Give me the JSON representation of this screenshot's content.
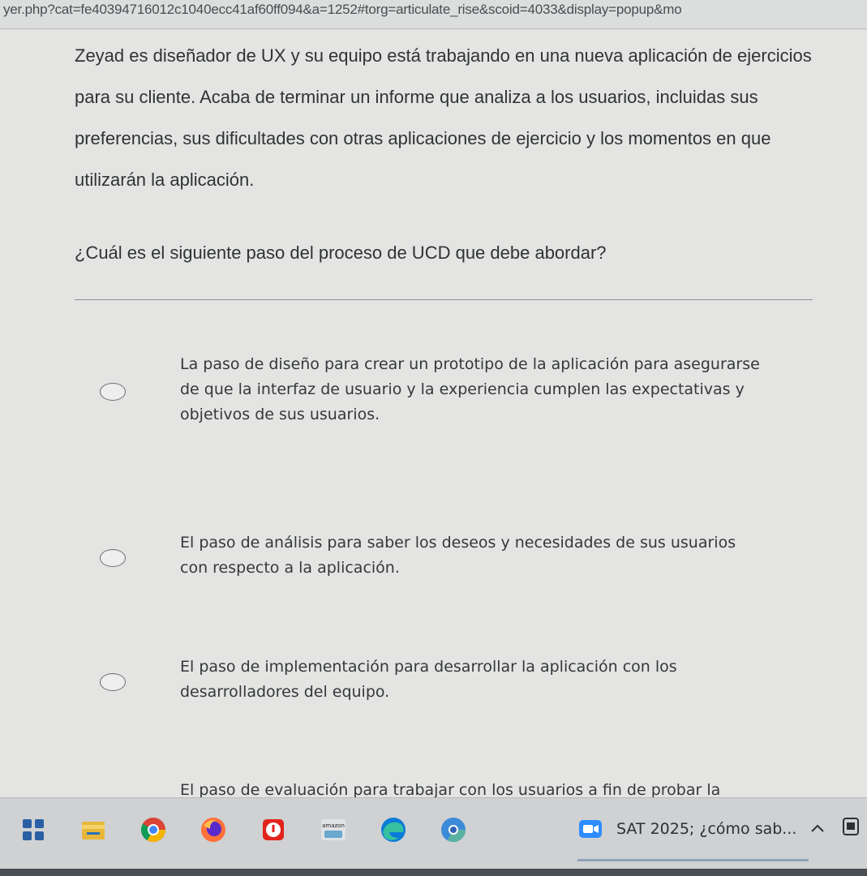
{
  "browser": {
    "url": "yer.php?cat=fe40394716012c1040ecc41af60ff094&a=1252#torg=articulate_rise&scoid=4033&display=popup&mo"
  },
  "question": {
    "body": "Zeyad es diseñador de UX y su equipo está trabajando en una nueva aplicación de ejercicios para su cliente. Acaba de terminar un informe que analiza a los usuarios, incluidas sus preferencias, sus dificultades con otras aplicaciones de ejercicio y los momentos en que utilizarán la aplicación.",
    "prompt": "¿Cuál es el siguiente paso del proceso de UCD que debe abordar?"
  },
  "options": [
    {
      "text": "La paso de diseño para crear un prototipo de la aplicación para asegurarse de que la interfaz de usuario y la experiencia cumplen las expectativas y objetivos de sus usuarios.",
      "selected": false
    },
    {
      "text": "El paso de análisis para saber los deseos y necesidades de sus usuarios con respecto a la aplicación.",
      "selected": false
    },
    {
      "text": "El paso de implementación para desarrollar la aplicación con los desarrolladores del equipo.",
      "selected": false
    },
    {
      "text": "El paso de evaluación para trabajar con los usuarios a fin de probar la aplicación y evaluar si el diseño satisface sus",
      "selected": false
    }
  ],
  "taskbar": {
    "icons": [
      "widgets-icon",
      "file-explorer-icon",
      "chrome-icon",
      "firefox-icon",
      "roblox-icon",
      "amazon-icon",
      "edge-icon",
      "chrome-beta-icon",
      "zoom-icon"
    ],
    "active_app_label": "SAT 2025; ¿cómo sab...",
    "accent_color": "#8fa3b8"
  }
}
